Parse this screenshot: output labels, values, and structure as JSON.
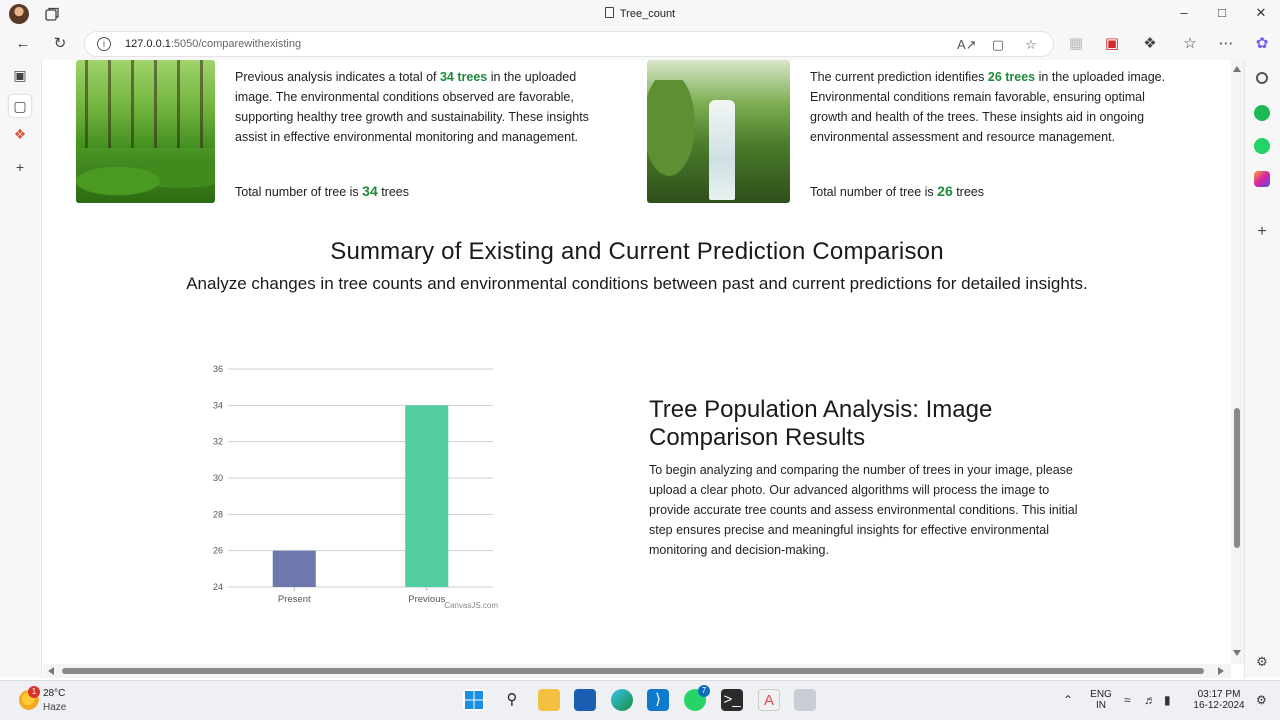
{
  "browser": {
    "tab_title": "Tree_count",
    "url_host": "127.0.0.1",
    "url_path": ":5050/comparewithexisting"
  },
  "previous": {
    "text_before": "Previous analysis indicates a total of ",
    "count_label": "34 trees",
    "text_after": " in the uploaded image. The environmental conditions observed are favorable, supporting healthy tree growth and sustainability. These insights assist in effective environmental monitoring and management.",
    "total_prefix": "Total number of tree is ",
    "total_value": "34",
    "total_suffix": " trees"
  },
  "current": {
    "text_before": "The current prediction identifies ",
    "count_label": "26 trees",
    "text_after": " in the uploaded image. Environmental conditions remain favorable, ensuring optimal growth and health of the trees. These insights aid in ongoing environmental assessment and resource management.",
    "total_prefix": "Total number of tree is ",
    "total_value": "26",
    "total_suffix": " trees"
  },
  "summary": {
    "title": "Summary of Existing and Current Prediction Comparison",
    "subtitle": "Analyze changes in tree counts and environmental conditions between past and current predictions for detailed insights."
  },
  "chart_data": {
    "type": "bar",
    "categories": [
      "Present",
      "Previous"
    ],
    "values": [
      26,
      34
    ],
    "colors": [
      "#6d78ad",
      "#51cda0"
    ],
    "ylim": [
      24,
      36
    ],
    "yticks": [
      24,
      26,
      28,
      30,
      32,
      34,
      36
    ],
    "grid": true,
    "credit": "CanvasJS.com"
  },
  "analysis": {
    "title": "Tree Population Analysis: Image Comparison Results",
    "body": "To begin analyzing and comparing the number of trees in your image, please upload a clear photo. Our advanced algorithms will process the image to provide accurate tree counts and assess environmental conditions. This initial step ensures precise and meaningful insights for effective environmental monitoring and decision-making."
  },
  "taskbar": {
    "temperature": "28°C",
    "condition": "Haze",
    "weather_badge": "1",
    "whatsapp_badge": "7",
    "lang_top": "ENG",
    "lang_bottom": "IN",
    "time": "03:17 PM",
    "date": "16-12-2024"
  }
}
